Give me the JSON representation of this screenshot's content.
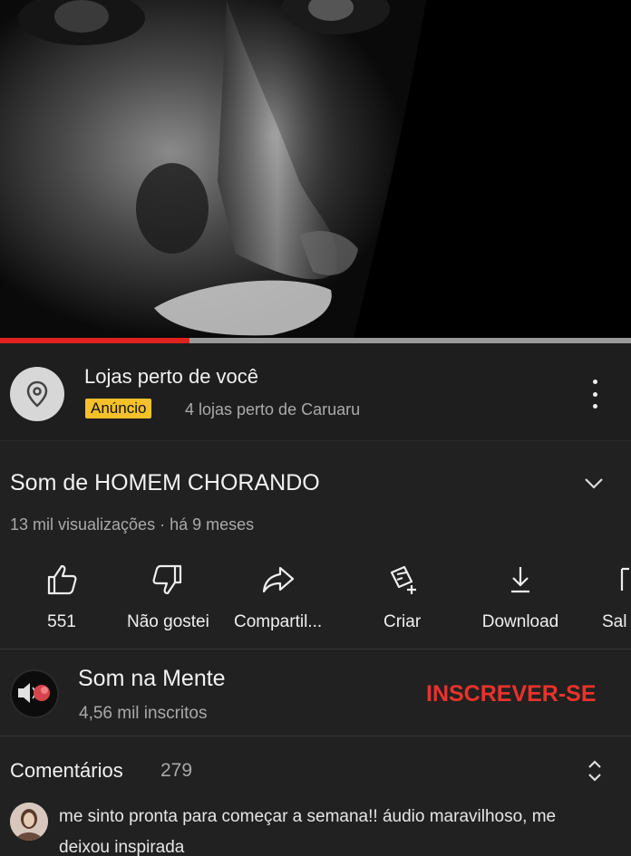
{
  "player": {
    "progress_fraction": 0.3
  },
  "ad": {
    "title": "Lojas perto de você",
    "badge": "Anúncio",
    "subtitle": "4 lojas perto de Caruaru",
    "icon": "location-pin-icon"
  },
  "video": {
    "title": "Som de HOMEM CHORANDO",
    "meta": "13 mil visualizações · há 9 meses"
  },
  "actions": {
    "like": "551",
    "dislike": "Não gostei",
    "share": "Compartil...",
    "create": "Criar",
    "download": "Download",
    "save": "Sal"
  },
  "channel": {
    "name": "Som na Mente",
    "subscribers": "4,56 mil inscritos",
    "subscribe": "INSCREVER-SE"
  },
  "comments": {
    "label": "Comentários",
    "count": "279",
    "first_comment": "me sinto pronta para começar a semana!! áudio maravilhoso, me deixou inspirada"
  },
  "colors": {
    "background": "#212121",
    "progress": "#e0231f",
    "badge": "#f4c12a",
    "subscribe": "#e8332b"
  }
}
